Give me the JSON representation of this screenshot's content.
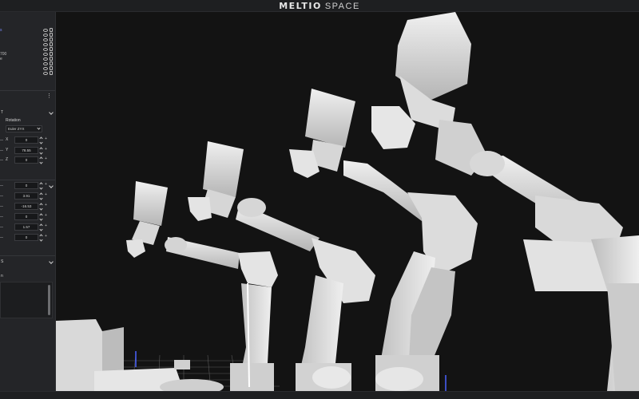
{
  "app": {
    "brand_primary": "MELTIO",
    "brand_secondary": "SPACE",
    "accent": "#7a8bff",
    "background": "#121212"
  },
  "toolbar": {
    "buttons": [
      {
        "icon": "move-icon"
      },
      {
        "icon": "rotate-icon"
      },
      {
        "icon": "home-icon"
      },
      {
        "icon": "layers-icon"
      }
    ]
  },
  "scene_tree": {
    "items": [
      {
        "label": "s",
        "selected": true
      },
      {
        "label": ""
      },
      {
        "label": ""
      },
      {
        "label": ""
      },
      {
        "label": ""
      },
      {
        "label": "700"
      },
      {
        "label": "e"
      },
      {
        "label": ""
      },
      {
        "label": ""
      },
      {
        "label": ""
      }
    ]
  },
  "transform": {
    "section_letter": "T",
    "rotation_label": "Rotation",
    "rotation_mode": "Euler ZYX",
    "fields": [
      {
        "axis": "X",
        "value": "0"
      },
      {
        "axis": "Y",
        "value": "78.55"
      },
      {
        "axis": "Z",
        "value": "0"
      }
    ]
  },
  "joints": {
    "values": [
      "0",
      "3.91",
      "-16.53",
      "0",
      "1.57",
      "0"
    ]
  },
  "section3": {
    "letter": "S",
    "item_letter": "n"
  }
}
